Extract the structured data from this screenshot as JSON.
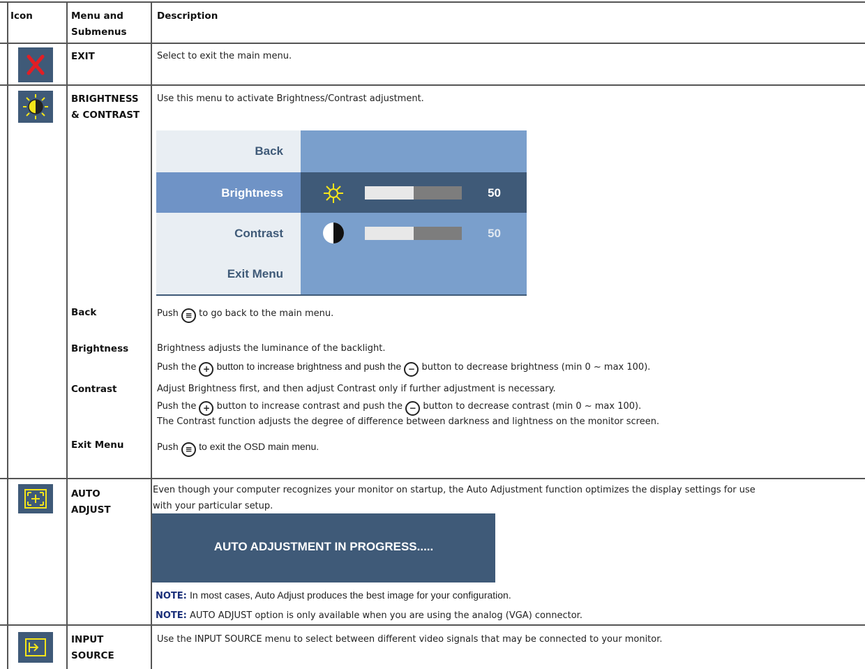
{
  "header": {
    "icon": "Icon",
    "menu_line1": "Menu and",
    "menu_line2": "Submenus",
    "description": "Description"
  },
  "exit_row": {
    "icon": "close-x-icon",
    "menu": "EXIT",
    "description": "Select to exit the main menu."
  },
  "brightness_row": {
    "icon": "sun-half-icon",
    "menu_line1": "BRIGHTNESS",
    "menu_line2": "& CONTRAST",
    "description": "Use this menu to activate Brightness/Contrast adjustment.",
    "osd": {
      "items": [
        "Back",
        "Brightness",
        "Contrast",
        "Exit Menu"
      ],
      "brightness_value": "50",
      "contrast_value": "50",
      "brightness_level": 0.5,
      "contrast_level": 0.5
    },
    "sub": {
      "back_label": "Back",
      "back_pre": "Push",
      "back_post": "to go back to the main menu.",
      "brightness_label": "Brightness",
      "brightness_line1": "Brightness adjusts the luminance of the backlight.",
      "brightness_pre": "Push the",
      "brightness_mid": "button to increase brightness and push the",
      "brightness_post": "button to decrease brightness (min 0 ~ max 100).",
      "contrast_label": "Contrast",
      "contrast_line1": "Adjust Brightness first, and then adjust Contrast only if further adjustment is necessary.",
      "contrast_pre": "Push the",
      "contrast_mid": "button to increase contrast and push the",
      "contrast_post": "button to decrease contrast (min 0 ~ max 100).",
      "contrast_line3": "The Contrast function adjusts the degree of difference between darkness and lightness on the monitor screen.",
      "exitmenu_label": "Exit Menu",
      "exitmenu_pre": "Push",
      "exitmenu_post": "to exit the OSD main menu."
    }
  },
  "auto_row": {
    "icon": "auto-adjust-icon",
    "menu_line1": "AUTO",
    "menu_line2": "ADJUST",
    "desc_line1": "Even though your computer recognizes your monitor on startup, the Auto Adjustment function optimizes the display settings for use",
    "desc_line2": "with your particular setup.",
    "banner": "AUTO ADJUSTMENT IN PROGRESS.....",
    "note_label": "NOTE:",
    "note1": "In most cases, Auto Adjust produces the best image for your configuration.",
    "note2": "AUTO ADJUST option is only available when you are using the analog (VGA) connector."
  },
  "input_row": {
    "icon": "input-source-icon",
    "menu_line1": "INPUT",
    "menu_line2": "SOURCE",
    "description": "Use the INPUT SOURCE menu to select between different video signals that may be connected to your monitor."
  },
  "colors": {
    "osd_light": "#7a9fcc",
    "osd_dark": "#3f5a78",
    "osd_panel": "#e9eef3",
    "icon_bg": "#3f5a78",
    "note": "#1a2f7a"
  }
}
